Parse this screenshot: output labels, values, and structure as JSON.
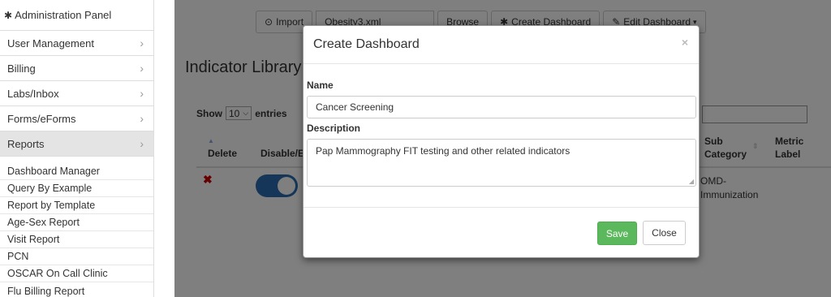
{
  "sidebar": {
    "panel_title": "Administration Panel",
    "items": [
      {
        "label": "User Management"
      },
      {
        "label": "Billing"
      },
      {
        "label": "Labs/Inbox"
      },
      {
        "label": "Forms/eForms"
      },
      {
        "label": "Reports"
      }
    ],
    "sub_items": [
      {
        "label": "Dashboard Manager"
      },
      {
        "label": "Query By Example"
      },
      {
        "label": "Report by Template"
      },
      {
        "label": "Age-Sex Report"
      },
      {
        "label": "Visit Report"
      },
      {
        "label": "PCN"
      },
      {
        "label": "OSCAR On Call Clinic"
      },
      {
        "label": "Flu Billing Report"
      }
    ]
  },
  "toolbar": {
    "import_label": "Import",
    "file_value": "Obesity3.xml",
    "browse_label": "Browse",
    "create_label": "Create Dashboard",
    "edit_label": "Edit Dashboard"
  },
  "library": {
    "title": "Indicator Library",
    "show_label": "Show",
    "entries_value": "10",
    "entries_label": "entries",
    "columns": {
      "delete": "Delete",
      "disable": "Disable/E",
      "sub_category_1": "Sub",
      "sub_category_2": "Category",
      "metric_1": "Metric",
      "metric_2": "Label"
    },
    "row": {
      "sub_category_1": "OMD-",
      "sub_category_2": "Immunization"
    }
  },
  "modal": {
    "title": "Create Dashboard",
    "name_label": "Name",
    "name_value": "Cancer Screening",
    "description_label": "Description",
    "description_value": "Pap Mammography FIT testing and other related indicators",
    "save_label": "Save",
    "close_label": "Close",
    "close_x": "×"
  },
  "colors": {
    "save_green": "#5cb85c",
    "toggle_blue": "#2b6cb0",
    "delete_red": "#cc0000"
  }
}
